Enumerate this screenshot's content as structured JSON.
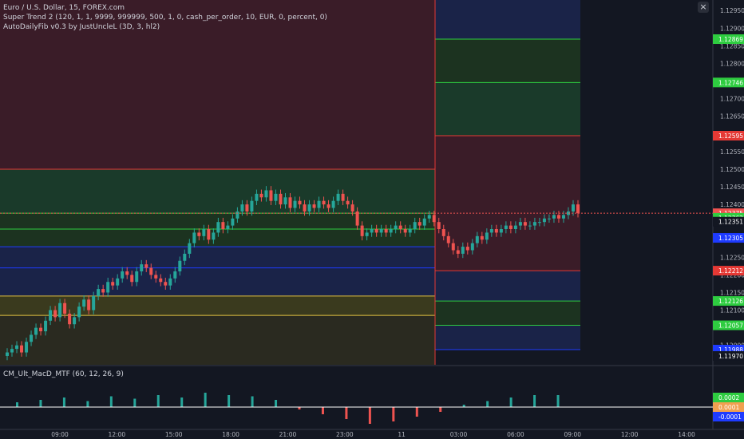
{
  "legend": {
    "symbol": "Euro / U.S. Dollar, 15, FOREX.com",
    "indicator1": "Super Trend 2 (120, 1, 1, 9999, 999999, 500, 1, 0, cash_per_order, 10, EUR, 0, percent, 0)",
    "indicator2": "AutoDailyFib v0.3 by JustUncleL (3D, 3, hl2)",
    "macd": "CM_Ult_MacD_MTF (60, 12, 26, 9)"
  },
  "ui": {
    "close_glyph": "×"
  },
  "colors": {
    "background": "#131722",
    "up": "#26a69a",
    "down": "#ef5350",
    "fib_red": "#e53935",
    "fib_green": "#2ecc40",
    "fib_blue": "#1e3bff",
    "fib_yellow": "#e0c040",
    "macd_line": "#21d121",
    "signal_line": "#f0a050"
  },
  "chart_data": {
    "type": "candlestick",
    "price_axis_ticks": [
      "1.12950",
      "1.12900",
      "1.12850",
      "1.12800",
      "1.12750",
      "1.12700",
      "1.12650",
      "1.12600",
      "1.12550",
      "1.12500",
      "1.12450",
      "1.12400",
      "1.12350",
      "1.12300",
      "1.12250",
      "1.12200",
      "1.12150",
      "1.12100",
      "1.12050",
      "1.12000",
      "1.11950"
    ],
    "price_labels": [
      {
        "value": "1.12869",
        "color": "#2ecc40"
      },
      {
        "value": "1.12746",
        "color": "#2ecc40"
      },
      {
        "value": "1.12595",
        "color": "#e53935"
      },
      {
        "value": "1.12375",
        "color": "#ef5350"
      },
      {
        "value": "09:19",
        "color": "#2a2e39"
      },
      {
        "value": "1.12362",
        "color": "#2ecc40"
      },
      {
        "value": "1.12351",
        "color": "#131722"
      },
      {
        "value": "1.12305",
        "color": "#1e3bff"
      },
      {
        "value": "1.12212",
        "color": "#e53935"
      },
      {
        "value": "1.12126",
        "color": "#2ecc40"
      },
      {
        "value": "1.12057",
        "color": "#2ecc40"
      },
      {
        "value": "1.11988",
        "color": "#1e3bff"
      },
      {
        "value": "1.11970",
        "color": "#131722"
      }
    ],
    "time_axis_ticks": [
      "09:00",
      "12:00",
      "15:00",
      "18:00",
      "21:00",
      "23:00",
      "11",
      "03:00",
      "06:00",
      "09:00",
      "12:00",
      "14:00"
    ],
    "fib_levels": {
      "day1": [
        1.125,
        1.12375,
        1.1233,
        1.1228,
        1.1222,
        1.1214,
        1.12085
      ],
      "day2": [
        1.12869,
        1.12746,
        1.12595,
        1.12212,
        1.12126,
        1.12057,
        1.11988
      ]
    },
    "close": [
      1.1198,
      1.1199,
      1.12,
      1.1198,
      1.1201,
      1.1203,
      1.1205,
      1.1204,
      1.1207,
      1.121,
      1.1208,
      1.1212,
      1.1209,
      1.1206,
      1.1208,
      1.1211,
      1.1213,
      1.121,
      1.1214,
      1.1216,
      1.1215,
      1.1218,
      1.1217,
      1.1219,
      1.1221,
      1.122,
      1.1218,
      1.1221,
      1.1223,
      1.1222,
      1.122,
      1.1219,
      1.1218,
      1.1217,
      1.1219,
      1.1221,
      1.1224,
      1.1226,
      1.1229,
      1.1232,
      1.1231,
      1.1233,
      1.123,
      1.1232,
      1.1235,
      1.1233,
      1.1234,
      1.1236,
      1.1238,
      1.124,
      1.1238,
      1.1241,
      1.1243,
      1.1242,
      1.1244,
      1.1241,
      1.1243,
      1.124,
      1.1242,
      1.1239,
      1.1241,
      1.124,
      1.1238,
      1.124,
      1.1239,
      1.1241,
      1.124,
      1.1239,
      1.1241,
      1.1243,
      1.1241,
      1.124,
      1.1238,
      1.1234,
      1.1231,
      1.1232,
      1.1233,
      1.1232,
      1.1233,
      1.1232,
      1.1233,
      1.1234,
      1.1233,
      1.1232,
      1.1233,
      1.1235,
      1.1234,
      1.1236,
      1.1237,
      1.1235,
      1.1233,
      1.1231,
      1.1229,
      1.1227,
      1.1226,
      1.1228,
      1.1227,
      1.1229,
      1.1231,
      1.123,
      1.1232,
      1.1233,
      1.1232,
      1.1233,
      1.1234,
      1.1233,
      1.1234,
      1.1235,
      1.1234,
      1.1234,
      1.1235,
      1.1235,
      1.1236,
      1.1236,
      1.1237,
      1.1236,
      1.1237,
      1.1238,
      1.124,
      1.12375
    ],
    "macd_hist": [
      4e-05,
      6e-05,
      8e-05,
      5e-05,
      9e-05,
      7e-05,
      0.0001,
      8e-05,
      0.00012,
      0.0001,
      9e-05,
      6e-05,
      -2e-05,
      -6e-05,
      -0.0001,
      -0.00014,
      -0.00012,
      -8e-05,
      -4e-05,
      2e-05,
      5e-05,
      8e-05,
      0.0001,
      0.0001
    ],
    "macd_labels": [
      {
        "value": "0.0002",
        "color": "#2ecc40"
      },
      {
        "value": "0.0001",
        "color": "#f0a050"
      },
      {
        "value": "-0.0001",
        "color": "#1e3bff"
      }
    ]
  }
}
